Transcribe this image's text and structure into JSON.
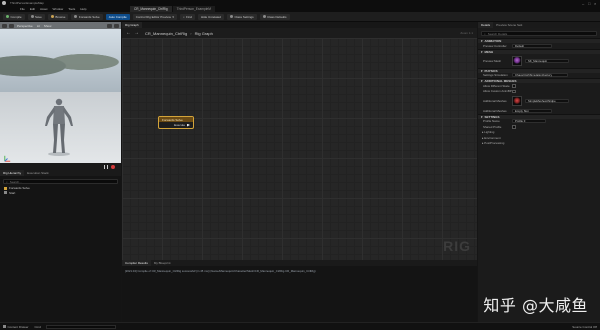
{
  "window": {
    "title": "ThirdPersonExampleMap",
    "menu": [
      "File",
      "Edit",
      "Asset",
      "Window",
      "Tools",
      "Help"
    ]
  },
  "doc_tabs": [
    "CR_Mannequin_CtrlRig",
    "ThirdPerson_ExampleM"
  ],
  "toolbar": {
    "buttons": [
      {
        "label": "Compile"
      },
      {
        "label": "Save"
      },
      {
        "label": "Browse"
      },
      {
        "label": "Forwards Solve"
      },
      {
        "label": "Auto Compile",
        "accent": true
      },
      {
        "label": "Control Rig Editor Preview"
      },
      {
        "label": "Find"
      },
      {
        "label": "Hide Unrelated"
      },
      {
        "label": "Class Settings"
      },
      {
        "label": "Class Defaults"
      }
    ]
  },
  "viewport": {
    "mode_label": "Perspective",
    "lit_label": "Lit",
    "show_label": "Show"
  },
  "left_panel": {
    "tabs": [
      "Rig Hierarchy",
      "Execution Stack"
    ],
    "search_placeholder": "Search...",
    "items": [
      "Forwards Solve",
      "Start"
    ]
  },
  "graph": {
    "tab_label": "Rig Graph",
    "breadcrumb": [
      "CR_Mannequin_CtrlRig",
      "Rig Graph"
    ],
    "zoom_label": "Zoom 1:1",
    "watermark": "RIG",
    "node": {
      "title": "Forwards Solve",
      "pin": "Execute"
    }
  },
  "compiler": {
    "tabs": [
      "Compiler Results",
      "My Blueprint"
    ],
    "line": "[2021.04] Compile of CR_Mannequin_CtrlRig successful! [in 45 ms] (/Game/Mannequin/Character/Mesh/CR_Mannequin_CtrlRig.CR_Mannequin_CtrlRig)"
  },
  "details": {
    "tabs": [
      "Details",
      "Preview Scene Sett"
    ],
    "search_placeholder": "Search Details",
    "sections": {
      "animation": {
        "label": "ANIMATION",
        "props": [
          {
            "k": "Preview Controller",
            "v": "Default"
          }
        ]
      },
      "mesh": {
        "label": "MESH",
        "props": [
          {
            "k": "Preview Mesh",
            "v": "SK_Mannequin"
          }
        ]
      },
      "physics": {
        "label": "PHYSICS",
        "props": [
          {
            "k": "Settings Simulation",
            "v": "ChaosClothSimulationFactory"
          }
        ]
      },
      "meshes": {
        "label": "ADDITIONAL MESHES",
        "props": [
          {
            "k": "Allow Different Skele",
            "v": ""
          },
          {
            "k": "Allow Custom AnimBP",
            "v": ""
          },
          {
            "k": "Additional Meshes",
            "v": "SimpleMeshes/thirdpe"
          },
          {
            "k": "Additional Meshes",
            "v": "Empty Slot"
          }
        ]
      },
      "settings": {
        "label": "SETTINGS",
        "props": [
          {
            "k": "Profile Name",
            "v": "Profile 0"
          },
          {
            "k": "Shared Profile",
            "v": ""
          }
        ]
      },
      "sub": [
        "Lighting",
        "Environment",
        "PostProcessing"
      ]
    }
  },
  "statusbar": {
    "left": [
      "Content Drawer",
      "Cmd"
    ],
    "right": [
      "Source Control Off"
    ]
  },
  "watermark": "知乎 @大咸鱼"
}
